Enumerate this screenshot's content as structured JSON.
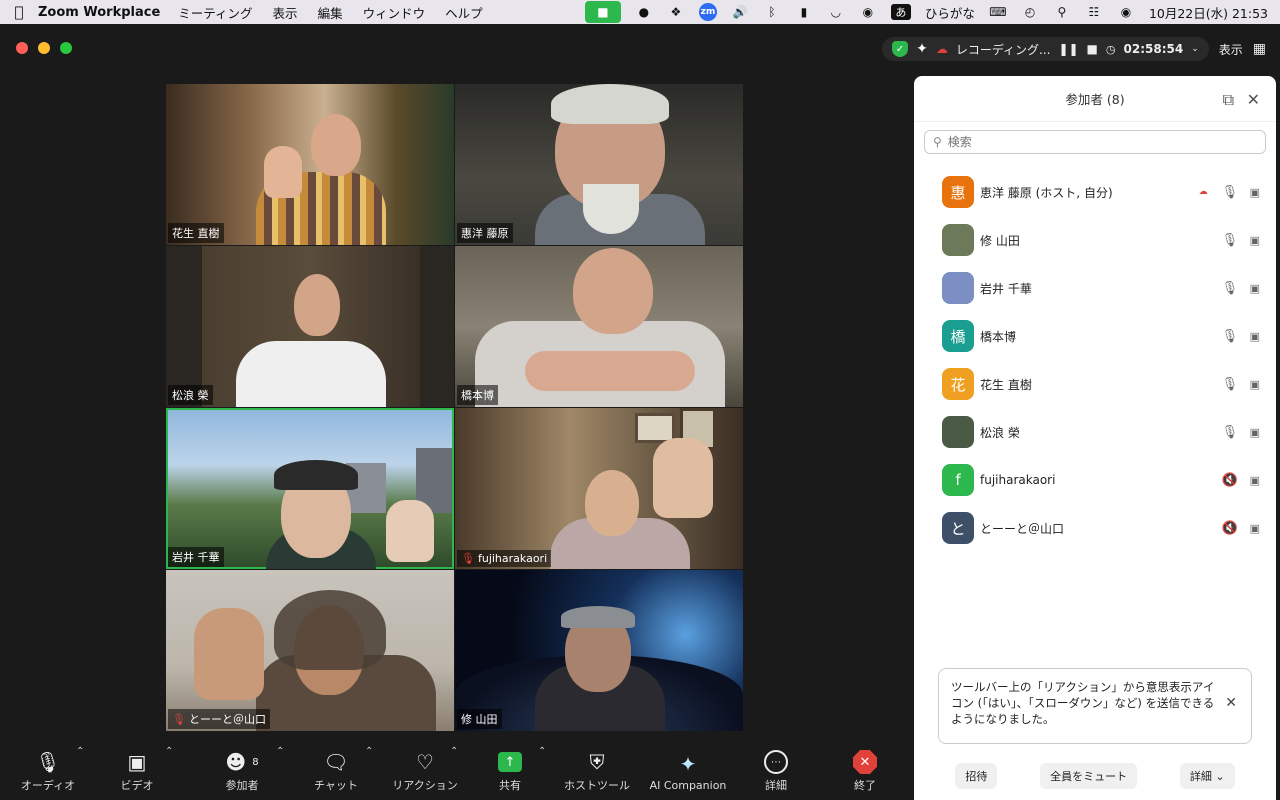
{
  "menubar": {
    "app_name": "Zoom Workplace",
    "menus": [
      "ミーティング",
      "表示",
      "編集",
      "ウィンドウ",
      "ヘルプ"
    ],
    "ime_box": "あ",
    "ime_label": "ひらがな",
    "datetime": "10月22日(水)  21:53"
  },
  "topbar": {
    "recording_label": "レコーディング...",
    "timer": "02:58:54",
    "view_label": "表示"
  },
  "tiles": [
    {
      "name": "花生 直樹",
      "muted": false
    },
    {
      "name": "惠洋 藤原",
      "muted": false
    },
    {
      "name": "松浪 榮",
      "muted": false
    },
    {
      "name": "橋本博",
      "muted": false
    },
    {
      "name": "岩井 千華",
      "muted": false
    },
    {
      "name": "fujiharakaori",
      "muted": true
    },
    {
      "name": "とーーと＠山口",
      "muted": true
    },
    {
      "name": "修 山田",
      "muted": false
    }
  ],
  "toolbar": {
    "audio": "オーディオ",
    "video": "ビデオ",
    "participants": "参加者",
    "participants_count": "8",
    "chat": "チャット",
    "reactions": "リアクション",
    "share": "共有",
    "host_tools": "ホストツール",
    "ai_companion": "AI Companion",
    "more": "詳細",
    "end": "終了"
  },
  "panel": {
    "title": "参加者 (8)",
    "search_placeholder": "検索",
    "participants": [
      {
        "name": "恵洋 藤原 (ホスト, 自分)",
        "initial": "惠",
        "color": "#e8720c",
        "mic": "on",
        "recording": true
      },
      {
        "name": "修 山田",
        "initial": "",
        "color": "#6d7a5a",
        "mic": "on",
        "recording": false
      },
      {
        "name": "岩井 千華",
        "initial": "",
        "color": "#7b8fc4",
        "mic": "on",
        "recording": false
      },
      {
        "name": "橋本博",
        "initial": "橋",
        "color": "#1a9e8f",
        "mic": "on",
        "recording": false
      },
      {
        "name": "花生 直樹",
        "initial": "花",
        "color": "#f0a020",
        "mic": "on",
        "recording": false
      },
      {
        "name": "松浪 榮",
        "initial": "",
        "color": "#4a5a44",
        "mic": "on",
        "recording": false
      },
      {
        "name": "fujiharakaori",
        "initial": "f",
        "color": "#2db84d",
        "mic": "off",
        "recording": false
      },
      {
        "name": "とーーと＠山口",
        "initial": "と",
        "color": "#3d5068",
        "mic": "off",
        "recording": false
      }
    ],
    "notice": "ツールバー上の「リアクション」から意思表示アイコン (「はい」、「スローダウン」など) を送信できるようになりました。",
    "footer": {
      "invite": "招待",
      "mute_all": "全員をミュート",
      "more": "詳細"
    }
  }
}
